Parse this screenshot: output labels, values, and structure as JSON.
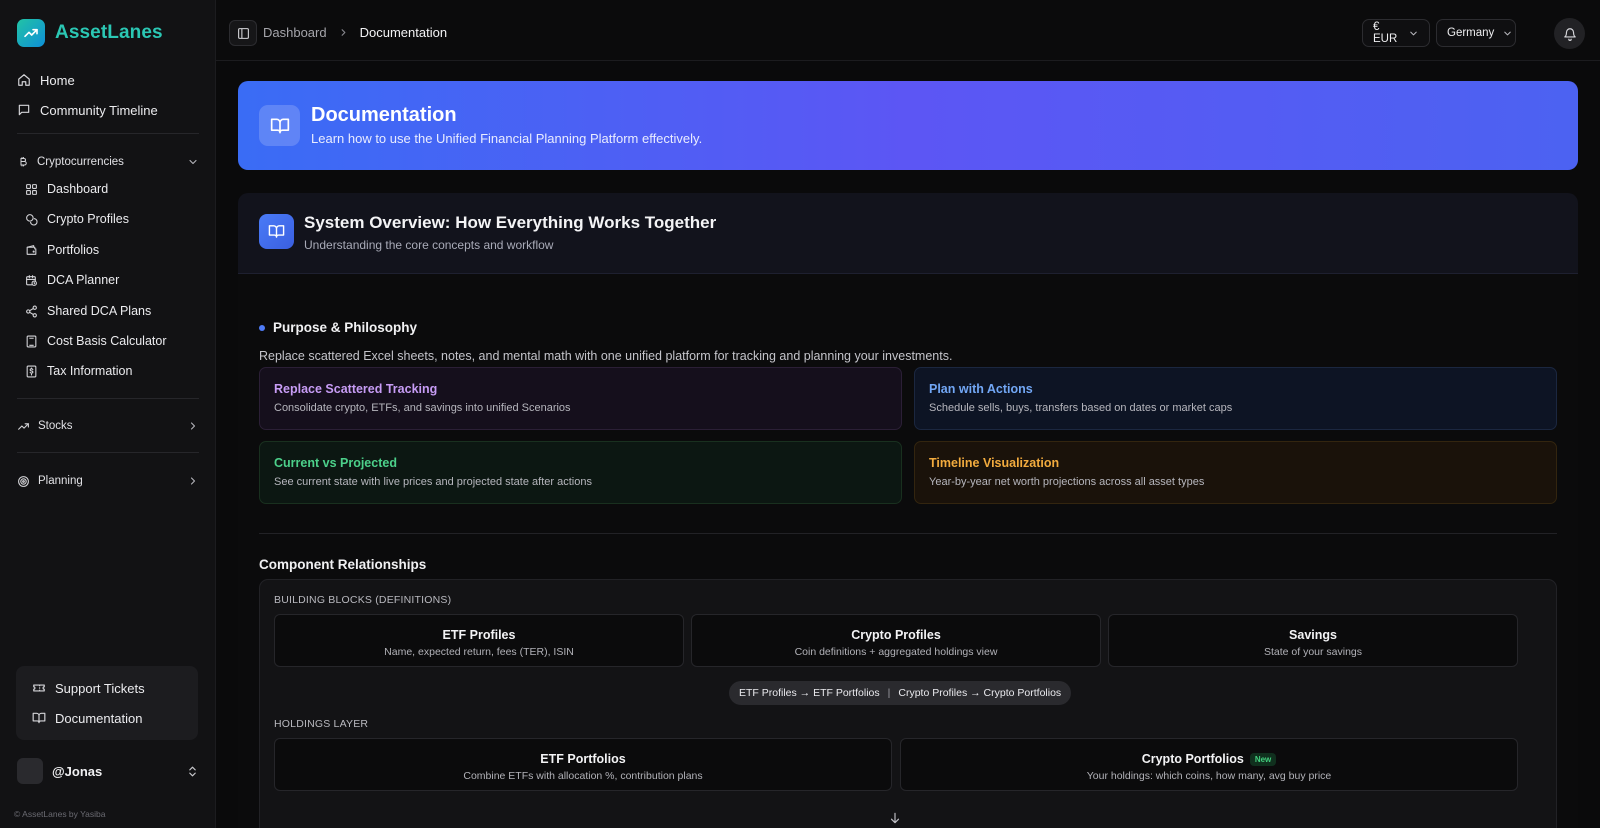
{
  "app": {
    "name": "AssetLanes",
    "copyright": "© AssetLanes by Yasiba"
  },
  "sidebar": {
    "top_items": [
      {
        "label": "Home",
        "icon": "home-icon"
      },
      {
        "label": "Community Timeline",
        "icon": "message-square-icon"
      }
    ],
    "crypto_section": {
      "label": "Cryptocurrencies",
      "icon": "bitcoin-icon",
      "expanded": true,
      "items": [
        {
          "label": "Dashboard",
          "icon": "grid-icon"
        },
        {
          "label": "Crypto Profiles",
          "icon": "coins-icon"
        },
        {
          "label": "Portfolios",
          "icon": "wallet-icon"
        },
        {
          "label": "DCA Planner",
          "icon": "calendar-clock-icon"
        },
        {
          "label": "Shared DCA Plans",
          "icon": "share-icon"
        },
        {
          "label": "Cost Basis Calculator",
          "icon": "calculator-icon"
        },
        {
          "label": "Tax Information",
          "icon": "receipt-icon"
        }
      ]
    },
    "stocks_section": {
      "label": "Stocks",
      "icon": "trending-up-icon"
    },
    "planning_section": {
      "label": "Planning",
      "icon": "target-icon"
    },
    "support": [
      {
        "label": "Support Tickets",
        "icon": "ticket-icon"
      },
      {
        "label": "Documentation",
        "icon": "book-open-icon"
      }
    ],
    "user": {
      "name": "@Jonas"
    }
  },
  "topbar": {
    "breadcrumb": [
      "Dashboard",
      "Documentation"
    ],
    "currency": "€ EUR",
    "country": "Germany"
  },
  "hero": {
    "title": "Documentation",
    "subtitle": "Learn how to use the Unified Financial Planning Platform effectively."
  },
  "overview": {
    "title": "System Overview: How Everything Works Together",
    "subtitle": "Understanding the core concepts and workflow",
    "purpose": {
      "title": "Purpose & Philosophy",
      "description": "Replace scattered Excel sheets, notes, and mental math with one unified platform for tracking and planning your investments."
    },
    "features": [
      {
        "title": "Replace Scattered Tracking",
        "description": "Consolidate crypto, ETFs, and savings into unified Scenarios",
        "color": "#c79cf5"
      },
      {
        "title": "Plan with Actions",
        "description": "Schedule sells, buys, transfers based on dates or market caps",
        "color": "#72a7f5"
      },
      {
        "title": "Current vs Projected",
        "description": "See current state with live prices and projected state after actions",
        "color": "#4cd08a"
      },
      {
        "title": "Timeline Visualization",
        "description": "Year-by-year net worth projections across all asset types",
        "color": "#f2ab3e"
      }
    ],
    "components": {
      "title": "Component Relationships",
      "building_blocks": {
        "label": "BUILDING BLOCKS (DEFINITIONS)",
        "blocks": [
          {
            "title": "ETF Profiles",
            "description": "Name, expected return, fees (TER), ISIN"
          },
          {
            "title": "Crypto Profiles",
            "description": "Coin definitions + aggregated holdings view"
          },
          {
            "title": "Savings",
            "description": "State of your savings"
          }
        ]
      },
      "flow": {
        "left": "ETF Profiles → ETF Portfolios",
        "separator": "|",
        "right": "Crypto Profiles → Crypto Portfolios"
      },
      "holdings": {
        "label": "HOLDINGS LAYER",
        "blocks": [
          {
            "title": "ETF Portfolios",
            "description": "Combine ETFs with allocation %, contribution plans"
          },
          {
            "title": "Crypto Portfolios",
            "badge": "New",
            "description": "Your holdings: which coins, how many, avg buy price"
          }
        ]
      }
    }
  },
  "colors": {
    "accent": "#4f7cf7",
    "brand": "#2bc7b4"
  }
}
